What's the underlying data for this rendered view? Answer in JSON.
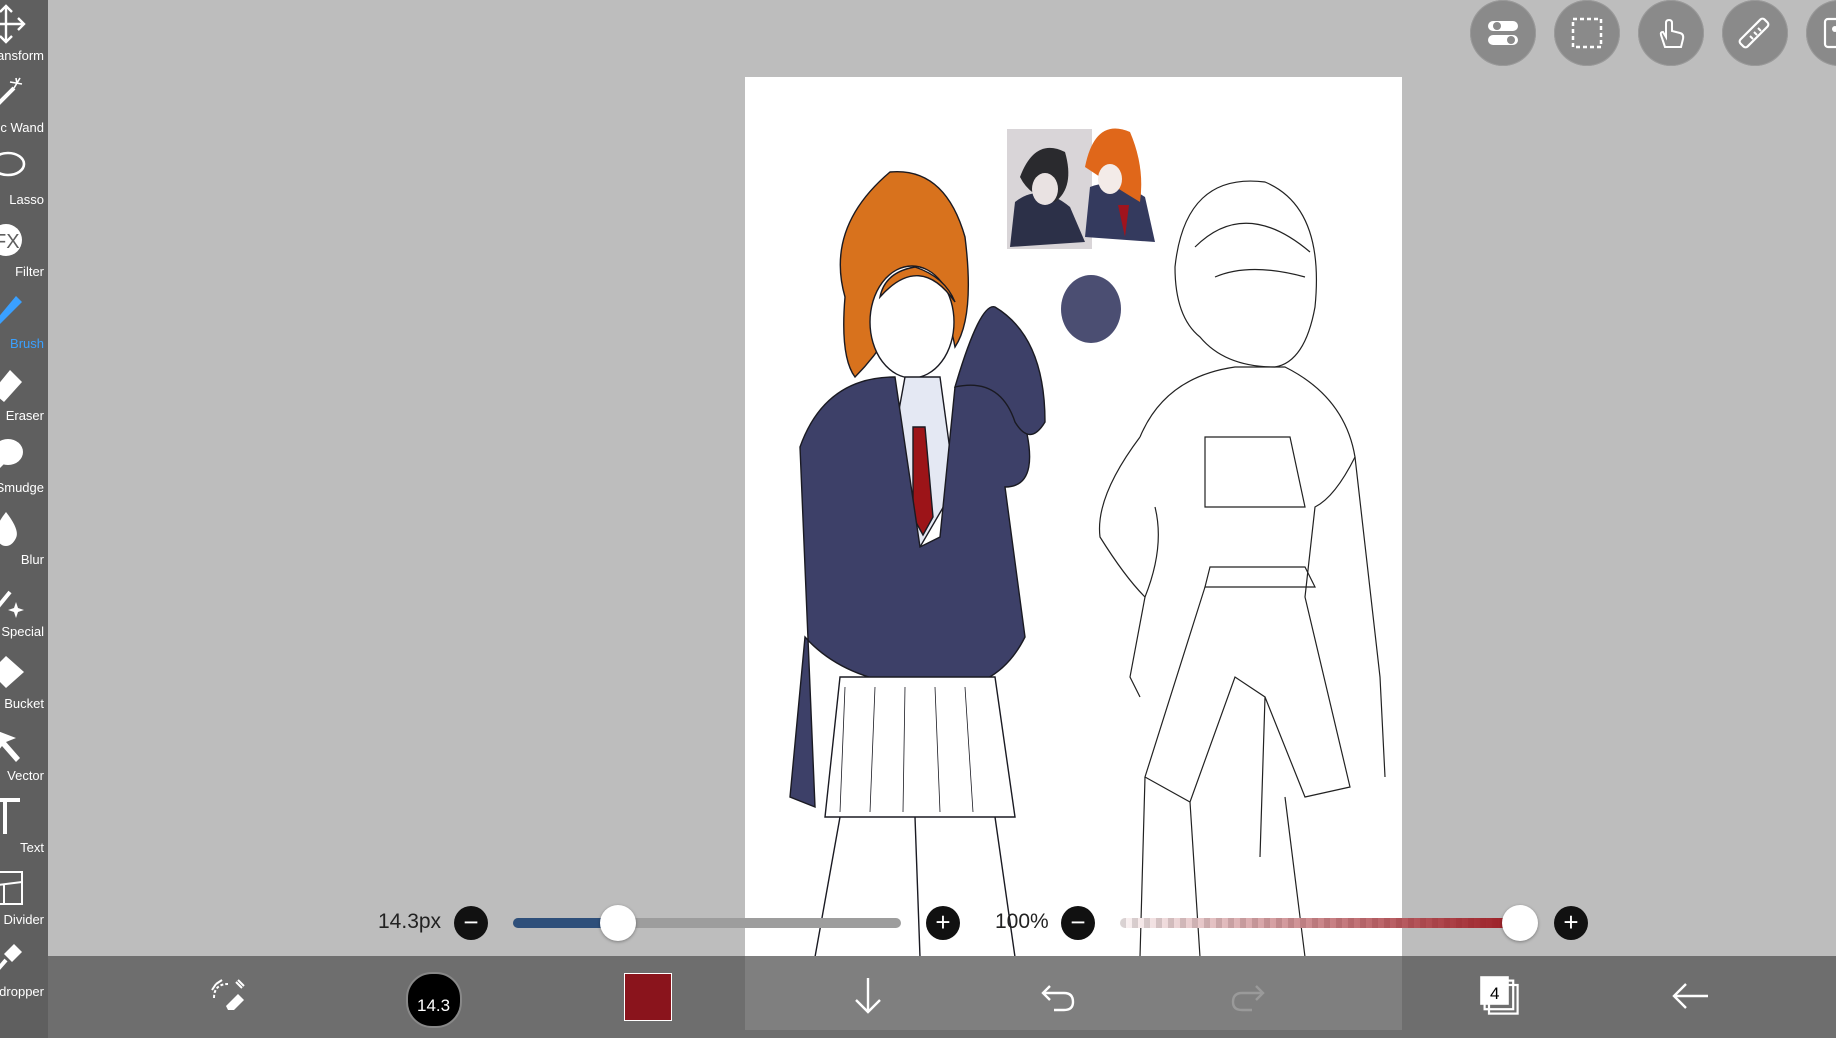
{
  "toolbar": {
    "items": [
      {
        "label": "Transform",
        "icon": "move-icon"
      },
      {
        "label": "Magic Wand",
        "icon": "magic-wand-icon"
      },
      {
        "label": "Lasso",
        "icon": "lasso-icon"
      },
      {
        "label": "Filter",
        "icon": "fx-icon"
      },
      {
        "label": "Brush",
        "icon": "brush-icon",
        "active": true
      },
      {
        "label": "Eraser",
        "icon": "eraser-icon"
      },
      {
        "label": "Smudge",
        "icon": "smudge-icon"
      },
      {
        "label": "Blur",
        "icon": "blur-drop-icon"
      },
      {
        "label": "Special",
        "icon": "special-brush-icon"
      },
      {
        "label": "Bucket",
        "icon": "bucket-icon"
      },
      {
        "label": "Vector",
        "icon": "vector-arrow-icon"
      },
      {
        "label": "Text",
        "icon": "text-icon"
      },
      {
        "label": "Frame Divider",
        "icon": "frame-divider-icon"
      },
      {
        "label": "Eyedropper",
        "icon": "eyedropper-icon"
      }
    ],
    "active_color": "#3aa0ff"
  },
  "top_buttons": [
    {
      "name": "toggle-icon"
    },
    {
      "name": "selection-icon"
    },
    {
      "name": "hand-touch-icon"
    },
    {
      "name": "ruler-icon"
    },
    {
      "name": "material-icon"
    }
  ],
  "brush_size": {
    "label": "14.3px",
    "value_fraction": 0.27,
    "minus": "−",
    "plus": "+",
    "track_color": "#2e4f7a"
  },
  "opacity": {
    "label": "100%",
    "value_fraction": 1.0,
    "minus": "−",
    "plus": "+",
    "track_color": "#9b1b22"
  },
  "bottom_bar": {
    "brush_size_badge": "14.3",
    "current_color": "#8a141c",
    "layers_count": "4"
  }
}
